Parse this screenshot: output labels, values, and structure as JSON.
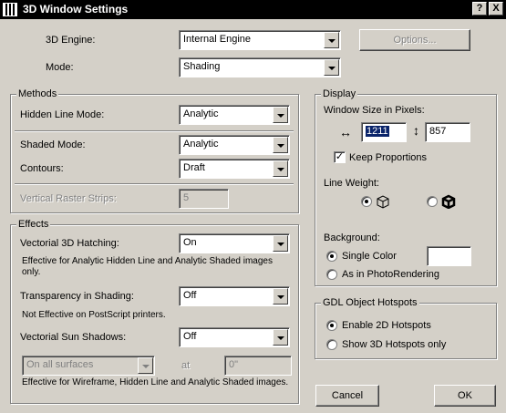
{
  "window": {
    "title": "3D Window Settings",
    "help_label": "?",
    "close_label": "X"
  },
  "engine": {
    "label": "3D Engine:",
    "value": "Internal Engine",
    "options_button": "Options..."
  },
  "mode": {
    "label": "Mode:",
    "value": "Shading"
  },
  "methods": {
    "title": "Methods",
    "hidden_line": {
      "label": "Hidden Line Mode:",
      "value": "Analytic"
    },
    "shaded": {
      "label": "Shaded Mode:",
      "value": "Analytic"
    },
    "contours": {
      "label": "Contours:",
      "value": "Draft"
    },
    "raster": {
      "label": "Vertical Raster Strips:",
      "value": "5"
    }
  },
  "effects": {
    "title": "Effects",
    "hatching": {
      "label": "Vectorial 3D Hatching:",
      "value": "On",
      "note": "Effective for Analytic Hidden Line and Analytic Shaded images only."
    },
    "transparency": {
      "label": "Transparency in Shading:",
      "value": "Off",
      "note": "Not Effective on PostScript printers."
    },
    "sun": {
      "label": "Vectorial Sun Shadows:",
      "value": "Off",
      "surfaces": "On all surfaces",
      "at_label": "at",
      "at_value": "0\"",
      "note": "Effective for Wireframe, Hidden Line and Analytic Shaded images."
    }
  },
  "display": {
    "title": "Display",
    "size_label": "Window Size in Pixels:",
    "width": "1211",
    "height": "857",
    "width_icon": "horizontal-arrows-icon",
    "height_icon": "vertical-arrows-icon",
    "keep_proportions": "Keep Proportions",
    "keep_proportions_checked": true,
    "line_weight_label": "Line Weight:",
    "line_weight_options": [
      "thin-lines-icon",
      "thick-lines-icon"
    ],
    "background_label": "Background:",
    "single_color": "Single Color",
    "photo": "As in PhotoRendering",
    "background_selected": "Single Color"
  },
  "gdl": {
    "title": "GDL Object Hotspots",
    "enable_2d": "Enable 2D Hotspots",
    "show_3d": "Show 3D Hotspots only",
    "selected": "Enable 2D Hotspots"
  },
  "buttons": {
    "cancel": "Cancel",
    "ok": "OK"
  }
}
